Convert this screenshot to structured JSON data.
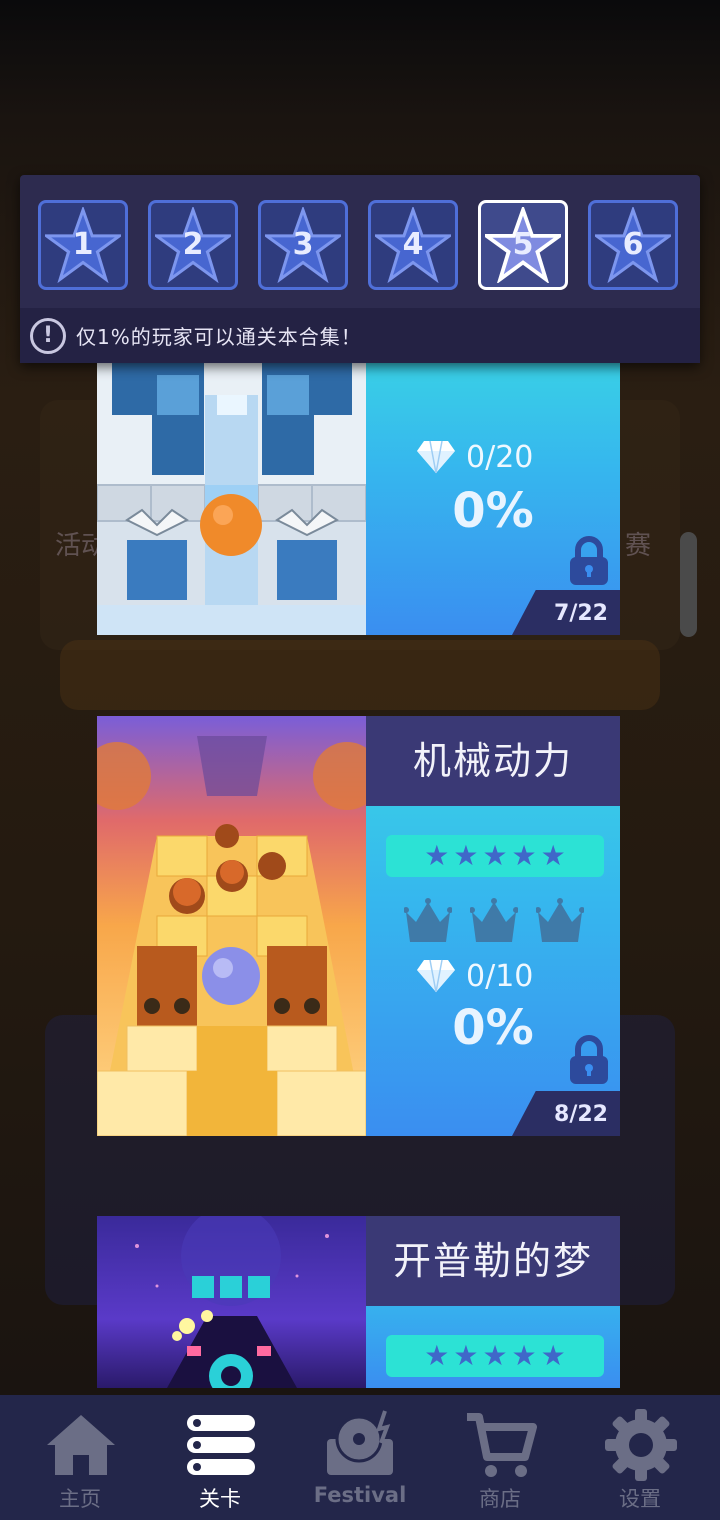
{
  "star_tabs": [
    {
      "num": "1",
      "active": false
    },
    {
      "num": "2",
      "active": false
    },
    {
      "num": "3",
      "active": false
    },
    {
      "num": "4",
      "active": false
    },
    {
      "num": "5",
      "active": true
    },
    {
      "num": "6",
      "active": false
    }
  ],
  "notice": {
    "icon": "!",
    "text": "仅1%的玩家可以通关本合集！"
  },
  "background_text": {
    "left": "活动",
    "right": "赛"
  },
  "levels": [
    {
      "title": "",
      "gems": "0/20",
      "progress": "0%",
      "progress_value": 0,
      "locked": true,
      "count": "7/22",
      "stars": 0,
      "crowns": 0
    },
    {
      "title": "机械动力",
      "gems": "0/10",
      "progress": "0%",
      "progress_value": 0,
      "locked": true,
      "count": "8/22",
      "stars": 5,
      "crowns": 3
    },
    {
      "title": "开普勒的梦",
      "stars": 5
    }
  ],
  "nav": [
    {
      "label": "主页",
      "icon": "home-icon",
      "active": false
    },
    {
      "label": "关卡",
      "icon": "list-icon",
      "active": true
    },
    {
      "label": "Festival",
      "icon": "turntable-icon",
      "active": false
    },
    {
      "label": "商店",
      "icon": "cart-icon",
      "active": false
    },
    {
      "label": "设置",
      "icon": "gear-icon",
      "active": false
    }
  ],
  "colors": {
    "tab_bg": "#2d2b4f",
    "tab_border": "#4f6fd8",
    "panel_title_bg": "#3a3975",
    "panel_gradient_top": "#3ad6e4",
    "panel_gradient_bottom": "#3a8ef0",
    "stars_bar": "#2ce2d5",
    "nav_bg": "#23264a",
    "nav_active": "#ffffff",
    "nav_inactive": "#6b6e86"
  }
}
